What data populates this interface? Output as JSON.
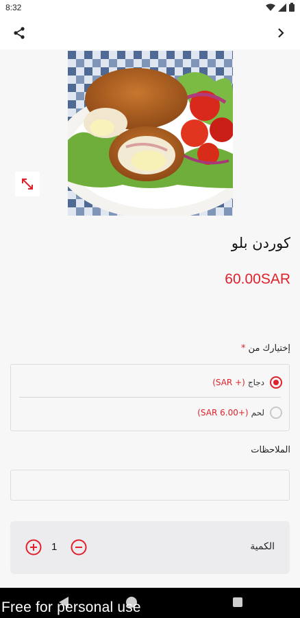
{
  "status_bar": {
    "time": "8:32",
    "icons": [
      "wifi-icon",
      "signal-icon",
      "battery-icon"
    ]
  },
  "app_bar": {
    "left_icon": "share-icon",
    "right_icon": "chevron-right-icon"
  },
  "product": {
    "image": "cordon-bleu-photo",
    "expand_icon": "expand-icon",
    "title": "كوردن بلو",
    "price": "60.00SAR"
  },
  "options": {
    "label": "إختيارك من",
    "required_mark": "*",
    "items": [
      {
        "name": "دجاج",
        "price": "(+ SAR)",
        "selected": true
      },
      {
        "name": "لحم",
        "price": "(+6.00 SAR)",
        "selected": false
      }
    ]
  },
  "notes": {
    "label": "الملاحظات",
    "value": "",
    "placeholder": ""
  },
  "quantity": {
    "label": "الكمية",
    "value": "1",
    "plus_icon": "plus-circle-icon",
    "minus_icon": "minus-circle-icon"
  },
  "watermark": "Free for personal use",
  "colors": {
    "accent": "#e0202a",
    "background": "#f7f7f7",
    "panel": "#ecebee"
  }
}
